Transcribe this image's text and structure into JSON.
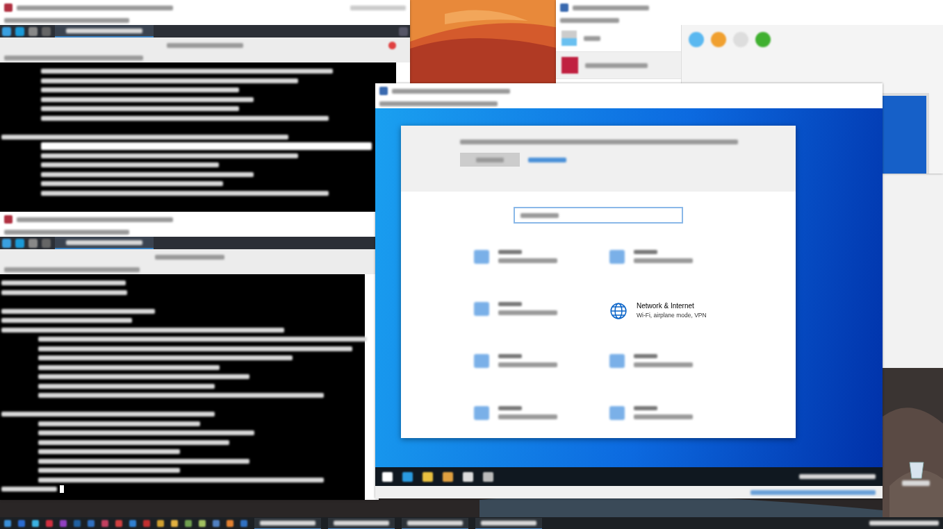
{
  "settings": {
    "tiles": [
      {
        "title": "Network & Internet",
        "subtitle": "Wi-Fi, airplane mode, VPN"
      }
    ]
  }
}
